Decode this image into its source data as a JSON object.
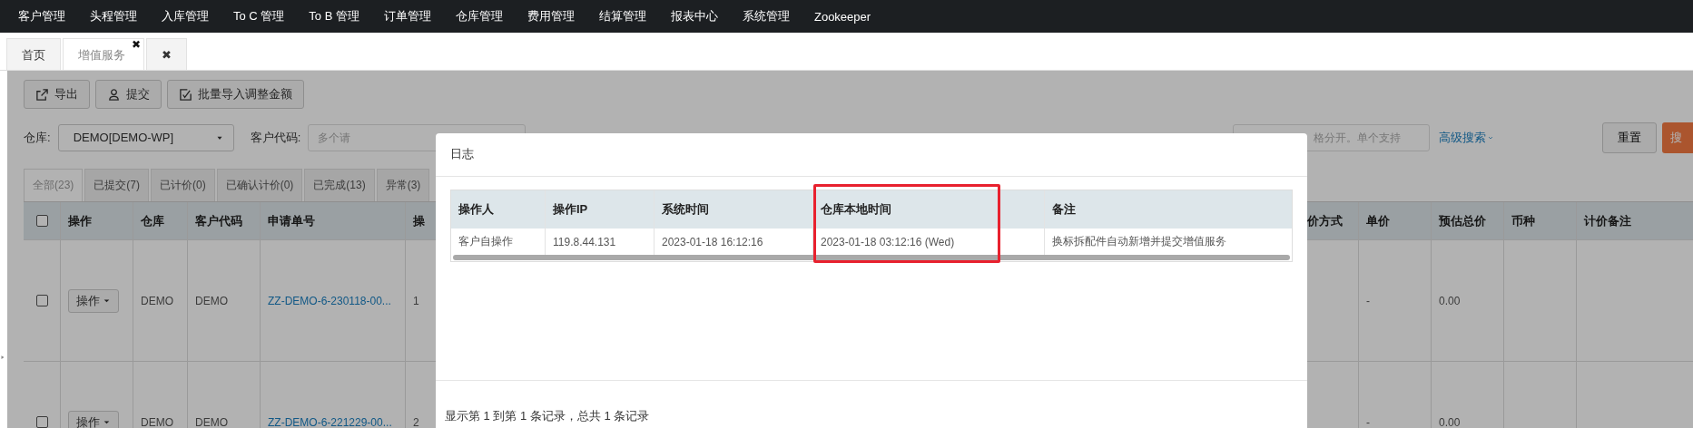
{
  "nav": {
    "items": [
      "客户管理",
      "头程管理",
      "入库管理",
      "To C 管理",
      "To B 管理",
      "订单管理",
      "仓库管理",
      "费用管理",
      "结算管理",
      "报表中心",
      "系统管理",
      "Zookeeper"
    ]
  },
  "page_tabs": [
    {
      "label": "首页",
      "selected": false
    },
    {
      "label": "增值服务",
      "selected": true,
      "close": "✖"
    },
    {
      "label": "✖",
      "selected": false
    }
  ],
  "toolbar": [
    {
      "label": "导出"
    },
    {
      "label": "提交"
    },
    {
      "label": "批量导入调整金额"
    }
  ],
  "filters": {
    "warehouse_label": "仓库:",
    "warehouse_value": "DEMO[DEMO-WP]",
    "customer_label": "客户代码:",
    "customer_placeholder": "多个请",
    "product_placeholder": "格分开。单个支持",
    "advanced_link": "高级搜索",
    "reset_button": "重置",
    "search_button": "搜"
  },
  "status_tabs": [
    {
      "label": "全部(23)",
      "selected": true
    },
    {
      "label": "已提交(7)",
      "selected": false
    },
    {
      "label": "已计价(0)",
      "selected": false
    },
    {
      "label": "已确认计价(0)",
      "selected": false
    },
    {
      "label": "已完成(13)",
      "selected": false
    },
    {
      "label": "异常(3)",
      "selected": false
    }
  ],
  "table": {
    "header_checked": false,
    "columns": [
      "操作",
      "仓库",
      "客户代码",
      "申请单号",
      "操",
      "价方式",
      "单价",
      "预估总价",
      "币种",
      "计价备注"
    ],
    "rows": [
      {
        "checked": false,
        "action": "操作",
        "warehouse": "DEMO",
        "customer": "DEMO",
        "request_no": "ZZ-DEMO-6-230118-00...",
        "column_6": "1",
        "unit_price": "-",
        "estimated_total": "0.00"
      },
      {
        "checked": false,
        "action": "操作",
        "warehouse": "DEMO",
        "customer": "DEMO",
        "request_no": "ZZ-DEMO-6-221229-00...",
        "column_6": "2",
        "unit_price": "-",
        "estimated_total": "0.00"
      }
    ]
  },
  "modal": {
    "title": "日志",
    "columns": [
      {
        "label": "操作人",
        "highlighted": false
      },
      {
        "label": "操作IP",
        "highlighted": false
      },
      {
        "label": "系统时间",
        "highlighted": false
      },
      {
        "label": "仓库本地时间",
        "highlighted": true
      },
      {
        "label": "备注",
        "highlighted": false
      }
    ],
    "rows": [
      [
        "客户自操作",
        "119.8.44.131",
        "2023-01-18 16:12:16",
        "2023-01-18 03:12:16 (Wed)",
        "换标拆配件自动新增并提交增值服务"
      ]
    ],
    "footer": "显示第 1 到第 1 条记录，总共 1 条记录"
  }
}
